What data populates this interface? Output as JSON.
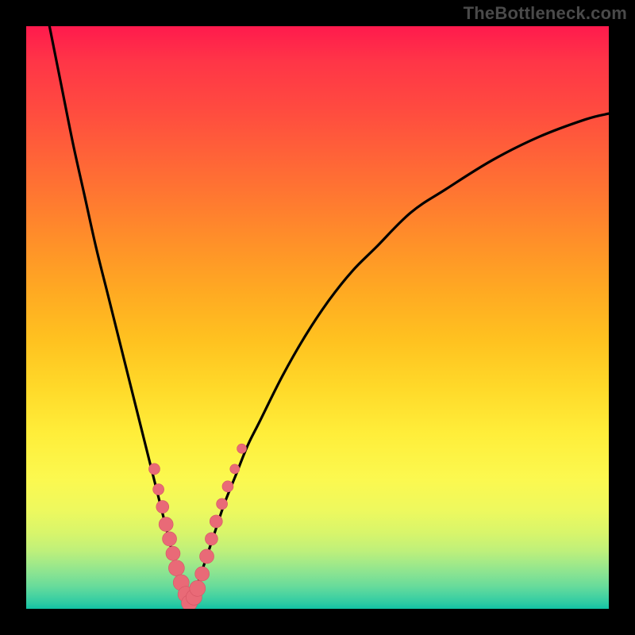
{
  "watermark": "TheBottleneck.com",
  "colors": {
    "background": "#000000",
    "curve": "#000000",
    "dot_fill": "#e96a77",
    "dot_stroke": "#d55564"
  },
  "chart_data": {
    "type": "line",
    "title": "",
    "xlabel": "",
    "ylabel": "",
    "xlim": [
      0,
      100
    ],
    "ylim": [
      0,
      100
    ],
    "grid": false,
    "legend": false,
    "series": [
      {
        "name": "left-branch",
        "x": [
          4,
          6,
          8,
          10,
          12,
          14,
          16,
          18,
          20,
          22,
          23,
          24,
          25,
          26,
          27,
          28
        ],
        "y": [
          100,
          90,
          80,
          71,
          62,
          54,
          46,
          38,
          30,
          22,
          18,
          14,
          10,
          6,
          3,
          1
        ]
      },
      {
        "name": "right-branch",
        "x": [
          28,
          29,
          30,
          31,
          32,
          34,
          36,
          38,
          40,
          44,
          48,
          52,
          56,
          60,
          66,
          72,
          80,
          88,
          96,
          100
        ],
        "y": [
          1,
          3,
          6,
          9,
          12,
          18,
          23,
          28,
          32,
          40,
          47,
          53,
          58,
          62,
          68,
          72,
          77,
          81,
          84,
          85
        ]
      }
    ],
    "scatter_points": {
      "name": "markers",
      "x": [
        22.0,
        22.7,
        23.4,
        24.0,
        24.6,
        25.2,
        25.8,
        26.6,
        27.4,
        28.0,
        28.8,
        29.4,
        30.2,
        31.0,
        31.8,
        32.6,
        33.6,
        34.6,
        35.8,
        37.0
      ],
      "y": [
        24.0,
        20.5,
        17.5,
        14.5,
        12.0,
        9.5,
        7.0,
        4.5,
        2.5,
        1.0,
        2.0,
        3.5,
        6.0,
        9.0,
        12.0,
        15.0,
        18.0,
        21.0,
        24.0,
        27.5
      ],
      "r": [
        7,
        7,
        8,
        9,
        9,
        9,
        10,
        10,
        10,
        10,
        10,
        10,
        9,
        9,
        8,
        8,
        7,
        7,
        6,
        6
      ]
    }
  }
}
